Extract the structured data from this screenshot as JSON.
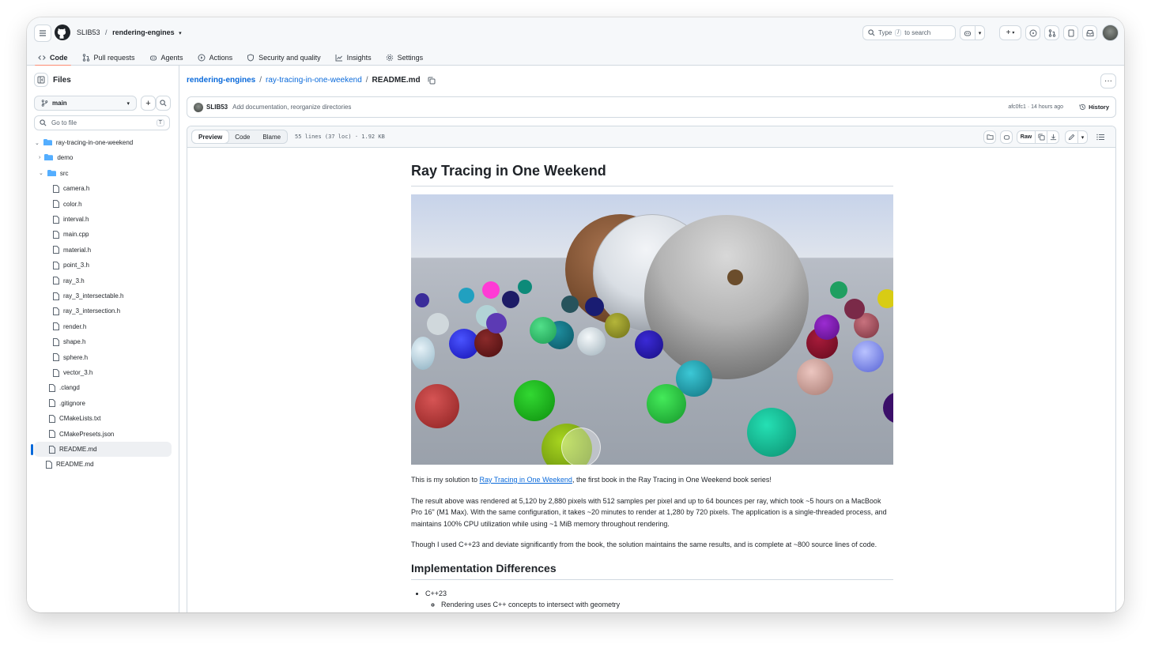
{
  "header": {
    "owner": "SLIB53",
    "separator": "/",
    "repo": "rendering-engines",
    "search_placeholder": "Type",
    "search_key": "/",
    "search_suffix": "to search"
  },
  "tabs": [
    {
      "label": "Code",
      "icon": "code-icon",
      "selected": true
    },
    {
      "label": "Pull requests",
      "icon": "pull-request-icon"
    },
    {
      "label": "Agents",
      "icon": "agent-icon"
    },
    {
      "label": "Actions",
      "icon": "play-icon"
    },
    {
      "label": "Security and quality",
      "icon": "shield-icon"
    },
    {
      "label": "Insights",
      "icon": "graph-icon"
    },
    {
      "label": "Settings",
      "icon": "gear-icon"
    }
  ],
  "sidebar": {
    "title": "Files",
    "branch": "main",
    "goto_placeholder": "Go to file",
    "goto_key": "T",
    "tree": [
      {
        "label": "ray-tracing-in-one-weekend",
        "type": "folder",
        "open": true,
        "indent": 0
      },
      {
        "label": "demo",
        "type": "folder",
        "open": false,
        "indent": 1
      },
      {
        "label": "src",
        "type": "folder",
        "open": true,
        "indent": 1
      },
      {
        "label": "camera.h",
        "type": "file",
        "indent": 2
      },
      {
        "label": "color.h",
        "type": "file",
        "indent": 2
      },
      {
        "label": "interval.h",
        "type": "file",
        "indent": 2
      },
      {
        "label": "main.cpp",
        "type": "file",
        "indent": 2
      },
      {
        "label": "material.h",
        "type": "file",
        "indent": 2
      },
      {
        "label": "point_3.h",
        "type": "file",
        "indent": 2
      },
      {
        "label": "ray_3.h",
        "type": "file",
        "indent": 2
      },
      {
        "label": "ray_3_intersectable.h",
        "type": "file",
        "indent": 2
      },
      {
        "label": "ray_3_intersection.h",
        "type": "file",
        "indent": 2
      },
      {
        "label": "render.h",
        "type": "file",
        "indent": 2
      },
      {
        "label": "shape.h",
        "type": "file",
        "indent": 2
      },
      {
        "label": "sphere.h",
        "type": "file",
        "indent": 2
      },
      {
        "label": "vector_3.h",
        "type": "file",
        "indent": 2
      },
      {
        "label": ".clangd",
        "type": "file",
        "indent": 1
      },
      {
        "label": ".gitignore",
        "type": "file",
        "indent": 1
      },
      {
        "label": "CMakeLists.txt",
        "type": "file",
        "indent": 1
      },
      {
        "label": "CMakePresets.json",
        "type": "file",
        "indent": 1
      },
      {
        "label": "README.md",
        "type": "file",
        "indent": 1,
        "selected": true
      },
      {
        "label": "README.md",
        "type": "file",
        "indent": 0
      }
    ]
  },
  "breadcrumb": {
    "root": "rendering-engines",
    "folder": "ray-tracing-in-one-weekend",
    "file": "README.md",
    "sep": "/"
  },
  "commit": {
    "author": "SLIB53",
    "message": "Add documentation, reorganize directories",
    "sha_time": "afc0fc1 · 14 hours ago",
    "history": "History"
  },
  "file_header": {
    "tabs": [
      "Preview",
      "Code",
      "Blame"
    ],
    "meta": "55 lines (37 loc) · 1.92 KB",
    "raw": "Raw"
  },
  "readme": {
    "title": "Ray Tracing in One Weekend",
    "p1_before": "This is my solution to ",
    "p1_link": "Ray Tracing in One Weekend",
    "p1_after": ", the first book in the Ray Tracing in One Weekend book series!",
    "p2": "The result above was rendered at 5,120 by 2,880 pixels with 512 samples per pixel and up to 64 bounces per ray, which took ~5 hours on a MacBook Pro 16\" (M1 Max). With the same configuration, it takes ~20 minutes to render at 1,280 by 720 pixels. The application is a single-threaded process, and maintains 100% CPU utilization while using ~1 MiB memory throughout rendering.",
    "p3": "Though I used C++23 and deviate significantly from the book, the solution maintains the same results, and is complete at ~800 source lines of code.",
    "h2": "Implementation Differences",
    "bullet1": "C++23",
    "sub1": "Rendering uses C++ concepts to intersect with geometry"
  },
  "colors": {
    "accent": "#0969da",
    "tab_underline": "#fd8c73",
    "border": "#d1d9e0"
  }
}
